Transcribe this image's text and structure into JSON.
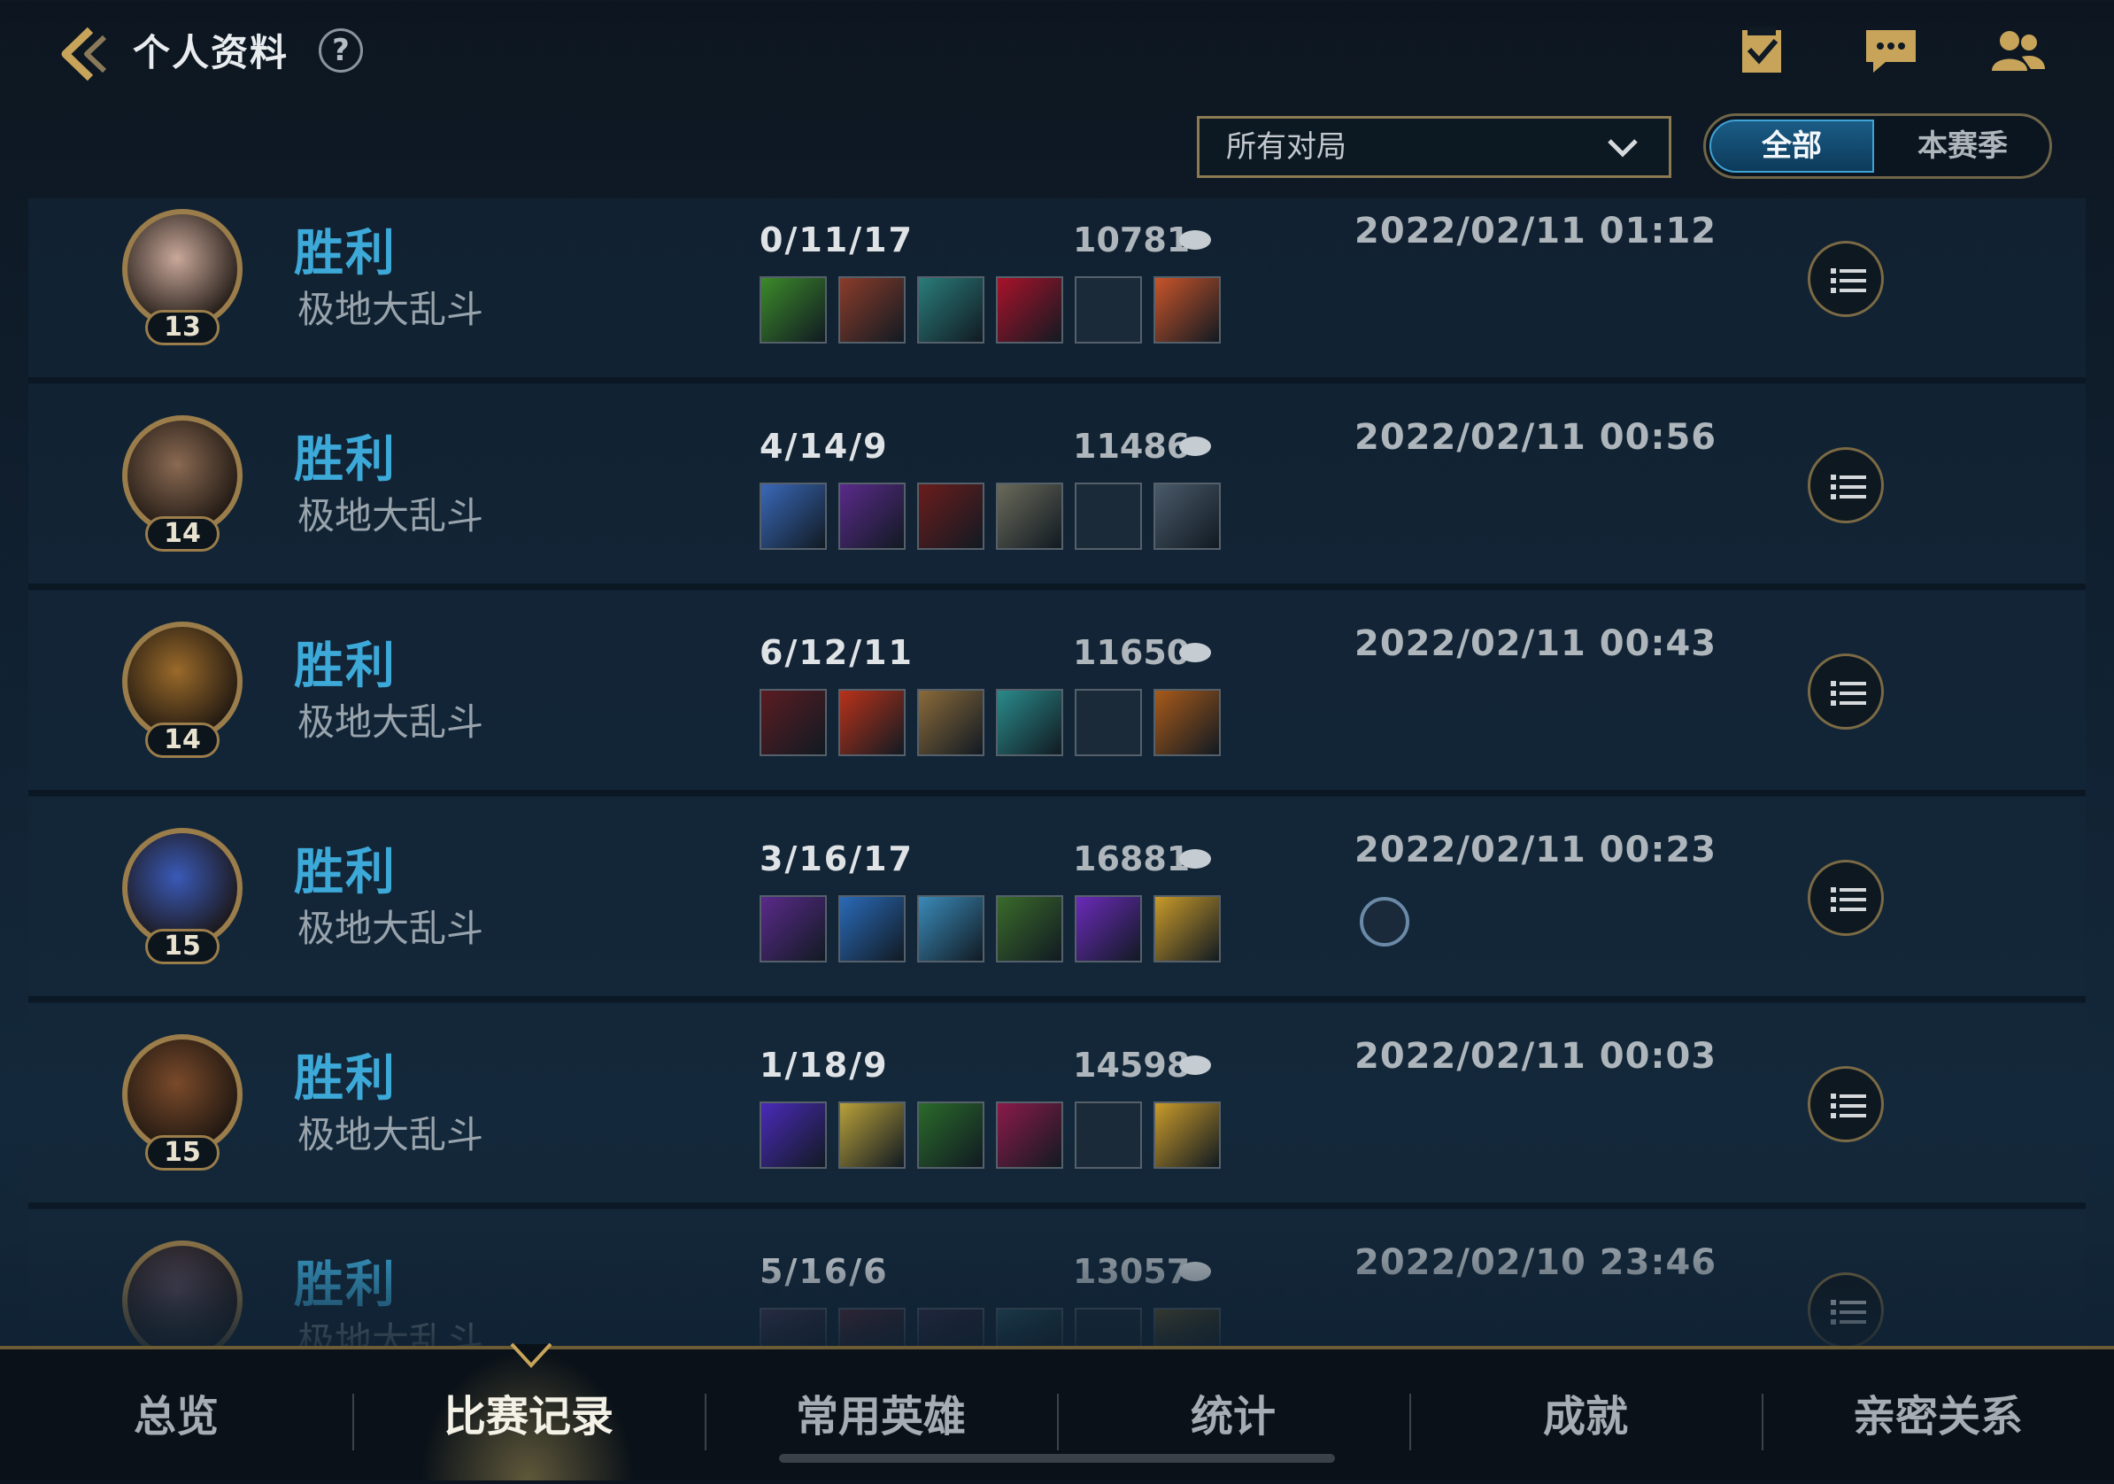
{
  "header": {
    "title": "个人资料",
    "help": "?",
    "icons": [
      "checklist-icon",
      "chat-icon",
      "friends-icon"
    ]
  },
  "filter": {
    "selected": "所有对局",
    "segments": {
      "all": "全部",
      "season": "本赛季",
      "active": "all"
    }
  },
  "matches": [
    {
      "level": "13",
      "result": "胜利",
      "mode": "极地大乱斗",
      "kda": "0/11/17",
      "gold": "10781",
      "date": "2022/02/11 01:12",
      "items": [
        "#3c8a2a",
        "#8a3c2a",
        "#2a7c7a",
        "#a8122a",
        "",
        "#c8542a"
      ]
    },
    {
      "level": "14",
      "result": "胜利",
      "mode": "极地大乱斗",
      "kda": "4/14/9",
      "gold": "11486",
      "date": "2022/02/11 00:56",
      "items": [
        "#3a68b8",
        "#5a2a8a",
        "#6a1c1c",
        "#6a6a5a",
        "",
        "#4a5a6a"
      ]
    },
    {
      "level": "14",
      "result": "胜利",
      "mode": "极地大乱斗",
      "kda": "6/12/11",
      "gold": "11650",
      "date": "2022/02/11 00:43",
      "items": [
        "#5a1c22",
        "#b8321a",
        "#8a6a3a",
        "#2a8a8a",
        "",
        "#a85a1a"
      ]
    },
    {
      "level": "15",
      "result": "胜利",
      "mode": "极地大乱斗",
      "kda": "3/16/17",
      "gold": "16881",
      "date": "2022/02/11 00:23",
      "items": [
        "#5a2a8a",
        "#2a6ab8",
        "#3a8ab8",
        "#3a6a2a",
        "#6a2ab8",
        "#c89a2a"
      ]
    },
    {
      "level": "15",
      "result": "胜利",
      "mode": "极地大乱斗",
      "kda": "1/18/9",
      "gold": "14598",
      "date": "2022/02/11 00:03",
      "items": [
        "#4a2ab8",
        "#b8a03a",
        "#2a6a2a",
        "#8a1a4a",
        "",
        "#c89a2a"
      ]
    },
    {
      "level": "",
      "result": "胜利",
      "mode": "极地大乱斗",
      "kda": "5/16/6",
      "gold": "13057",
      "date": "2022/02/10 23:46",
      "items": [
        "#4a3a5a",
        "#5a2a3a",
        "#3a2a4a",
        "#2a5a6a",
        "",
        "#6a5a2a"
      ]
    }
  ],
  "tabs": [
    "总览",
    "比赛记录",
    "常用英雄",
    "统计",
    "成就",
    "亲密关系"
  ],
  "active_tab": "比赛记录"
}
